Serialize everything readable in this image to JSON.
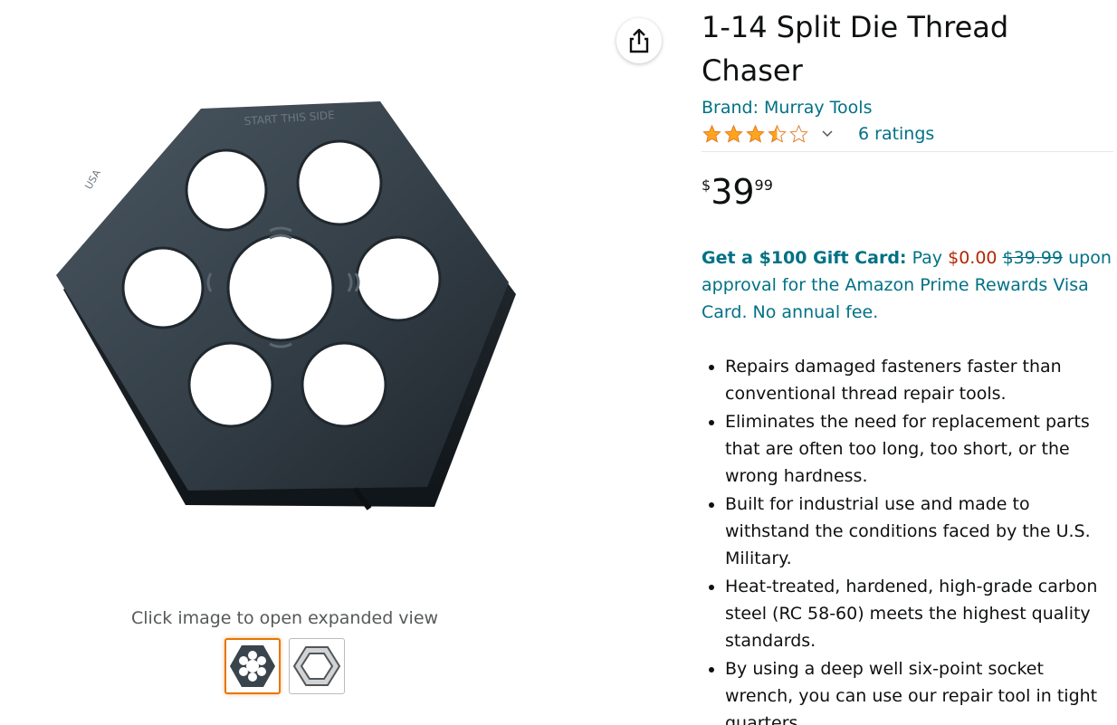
{
  "share": {
    "icon": "share-icon"
  },
  "gallery": {
    "zoom_hint": "Click image to open expanded view",
    "main_image": "hex-split-die-photo",
    "thumbnails": [
      {
        "icon": "hex-die-thumbnail",
        "selected": true
      },
      {
        "icon": "hex-die-outline-thumbnail",
        "selected": false
      }
    ]
  },
  "product": {
    "title": "1-14 Split Die Thread Chaser",
    "brand": "Brand: Murray Tools",
    "rating": {
      "stars": 3.5,
      "count_label": "6 ratings"
    },
    "price": {
      "symbol": "$",
      "whole": "39",
      "fraction": "99"
    },
    "promo": {
      "headline": "Get a $100 Gift Card:",
      "pay": "Pay",
      "new_price": "$0.00",
      "old_price": "$39.99",
      "rest": "upon approval for the Amazon Prime Rewards Visa Card. No annual fee."
    },
    "bullets": [
      "Repairs damaged fasteners faster than conventional thread repair tools.",
      "Eliminates the need for replacement parts that are often too long, too short, or the wrong hardness.",
      "Built for industrial use and made to withstand the conditions faced by the U.S. Military.",
      "Heat-treated, hardened, high-grade carbon steel (RC 58-60) meets the highest quality standards.",
      "By using a deep well six-point socket wrench, you can use our repair tool in tight quarters."
    ]
  },
  "colors": {
    "link": "#007185",
    "price_red": "#b12704",
    "star": "#ffa41c",
    "thumb_selected": "#e77600"
  }
}
